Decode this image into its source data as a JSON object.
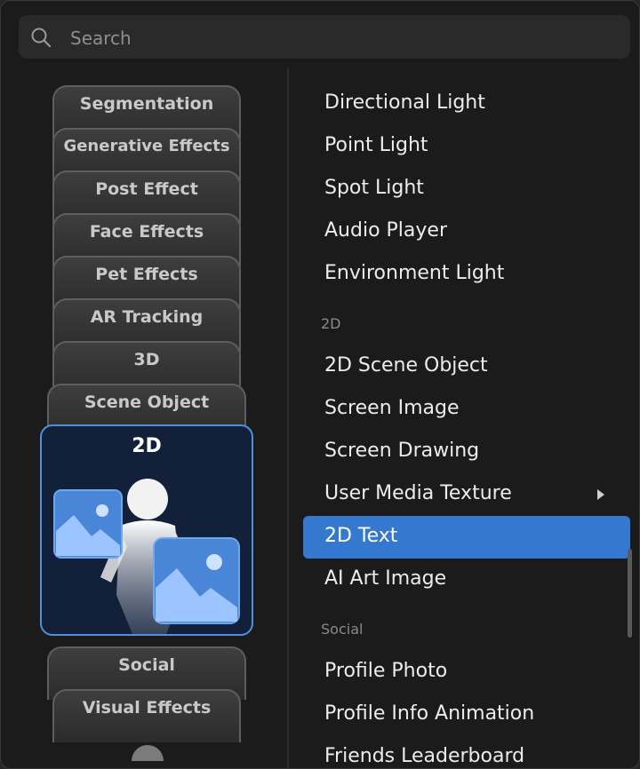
{
  "search": {
    "placeholder": "Search",
    "icon": "search-icon"
  },
  "categories": {
    "items": [
      "Segmentation",
      "Generative Effects",
      "Post Effect",
      "Face Effects",
      "Pet Effects",
      "AR Tracking",
      "3D",
      "Scene Object"
    ],
    "selected": "2D",
    "below": [
      "Social",
      "Visual Effects"
    ]
  },
  "list": {
    "items_top": [
      "Directional Light",
      "Point Light",
      "Spot Light",
      "Audio Player",
      "Environment Light"
    ],
    "section_2d": "2D",
    "items_2d": [
      "2D Scene Object",
      "Screen Image",
      "Screen Drawing",
      "User Media Texture",
      "2D Text",
      "AI Art Image"
    ],
    "section_social": "Social",
    "items_social": [
      "Profile Photo",
      "Profile Info Animation",
      "Friends Leaderboard"
    ],
    "highlighted": "2D Text",
    "has_submenu": "User Media Texture"
  },
  "colors": {
    "accent": "#3478d0",
    "selected_border": "#4f8fdd",
    "panel": "#1b1b1b"
  }
}
